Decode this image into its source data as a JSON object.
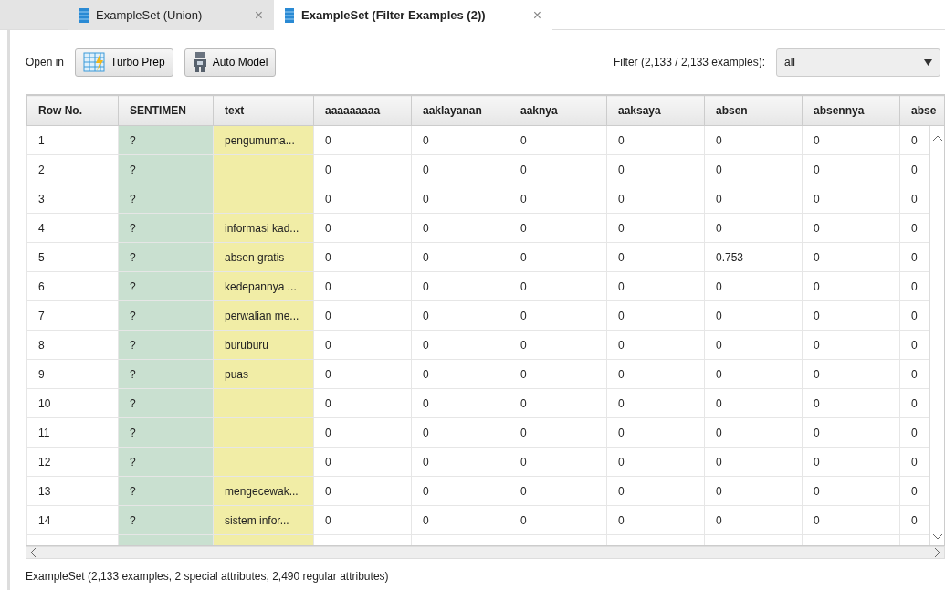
{
  "tabs": [
    {
      "label": "ExampleSet (Union)",
      "selected": false,
      "close": "×"
    },
    {
      "label": "ExampleSet (Filter Examples (2))",
      "selected": true,
      "close": "×"
    }
  ],
  "toolbar": {
    "open_in_label": "Open in",
    "buttons": [
      "Turbo Prep",
      "Auto Model"
    ],
    "filter_label": "Filter (2,133 / 2,133 examples):",
    "filter_value": "all"
  },
  "table": {
    "columns": [
      {
        "label": "Row No.",
        "kind": "id"
      },
      {
        "label": "SENTIMEN",
        "kind": "special"
      },
      {
        "label": "text",
        "kind": "text"
      },
      {
        "label": "aaaaaaaaa",
        "kind": "regular"
      },
      {
        "label": "aaklayanan",
        "kind": "regular"
      },
      {
        "label": "aaknya",
        "kind": "regular"
      },
      {
        "label": "aaksaya",
        "kind": "regular"
      },
      {
        "label": "absen",
        "kind": "regular"
      },
      {
        "label": "absennya",
        "kind": "regular"
      },
      {
        "label": "abse",
        "kind": "regular"
      }
    ],
    "rows": [
      [
        "1",
        "?",
        "pengumuma...",
        "0",
        "0",
        "0",
        "0",
        "0",
        "0",
        "0"
      ],
      [
        "2",
        "?",
        "",
        "0",
        "0",
        "0",
        "0",
        "0",
        "0",
        "0"
      ],
      [
        "3",
        "?",
        "",
        "0",
        "0",
        "0",
        "0",
        "0",
        "0",
        "0"
      ],
      [
        "4",
        "?",
        "informasi kad...",
        "0",
        "0",
        "0",
        "0",
        "0",
        "0",
        "0"
      ],
      [
        "5",
        "?",
        "absen gratis",
        "0",
        "0",
        "0",
        "0",
        "0.753",
        "0",
        "0"
      ],
      [
        "6",
        "?",
        "kedepannya ...",
        "0",
        "0",
        "0",
        "0",
        "0",
        "0",
        "0"
      ],
      [
        "7",
        "?",
        "perwalian me...",
        "0",
        "0",
        "0",
        "0",
        "0",
        "0",
        "0"
      ],
      [
        "8",
        "?",
        "buruburu",
        "0",
        "0",
        "0",
        "0",
        "0",
        "0",
        "0"
      ],
      [
        "9",
        "?",
        "puas",
        "0",
        "0",
        "0",
        "0",
        "0",
        "0",
        "0"
      ],
      [
        "10",
        "?",
        "",
        "0",
        "0",
        "0",
        "0",
        "0",
        "0",
        "0"
      ],
      [
        "11",
        "?",
        "",
        "0",
        "0",
        "0",
        "0",
        "0",
        "0",
        "0"
      ],
      [
        "12",
        "?",
        "",
        "0",
        "0",
        "0",
        "0",
        "0",
        "0",
        "0"
      ],
      [
        "13",
        "?",
        "mengecewak...",
        "0",
        "0",
        "0",
        "0",
        "0",
        "0",
        "0"
      ],
      [
        "14",
        "?",
        "sistem infor...",
        "0",
        "0",
        "0",
        "0",
        "0",
        "0",
        "0"
      ]
    ]
  },
  "status_bar": "ExampleSet (2,133 examples, 2 special attributes, 2,490 regular attributes)"
}
